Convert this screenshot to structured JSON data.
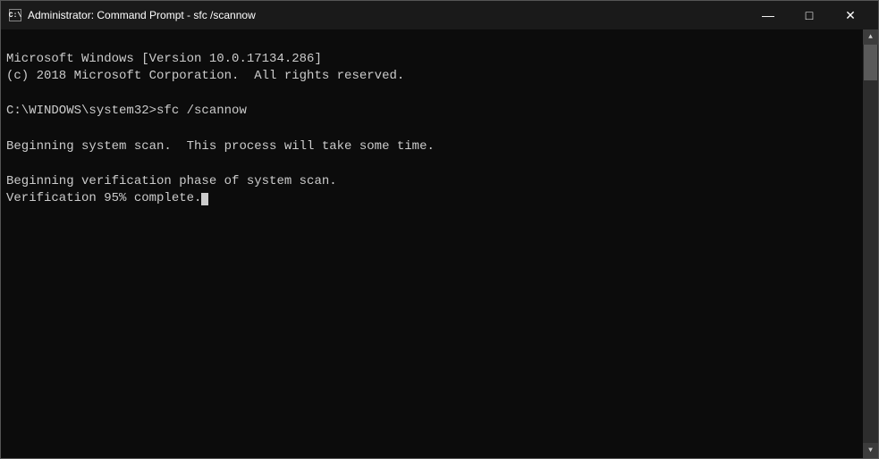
{
  "window": {
    "title": "Administrator: Command Prompt - sfc /scannow",
    "icon_label": "C:\\",
    "minimize_label": "—",
    "maximize_label": "□",
    "close_label": "✕"
  },
  "console": {
    "line1": "Microsoft Windows [Version 10.0.17134.286]",
    "line2": "(c) 2018 Microsoft Corporation.  All rights reserved.",
    "line3": "",
    "line4": "C:\\WINDOWS\\system32>sfc /scannow",
    "line5": "",
    "line6": "Beginning system scan.  This process will take some time.",
    "line7": "",
    "line8": "Beginning verification phase of system scan.",
    "line9": "Verification 95% complete."
  }
}
